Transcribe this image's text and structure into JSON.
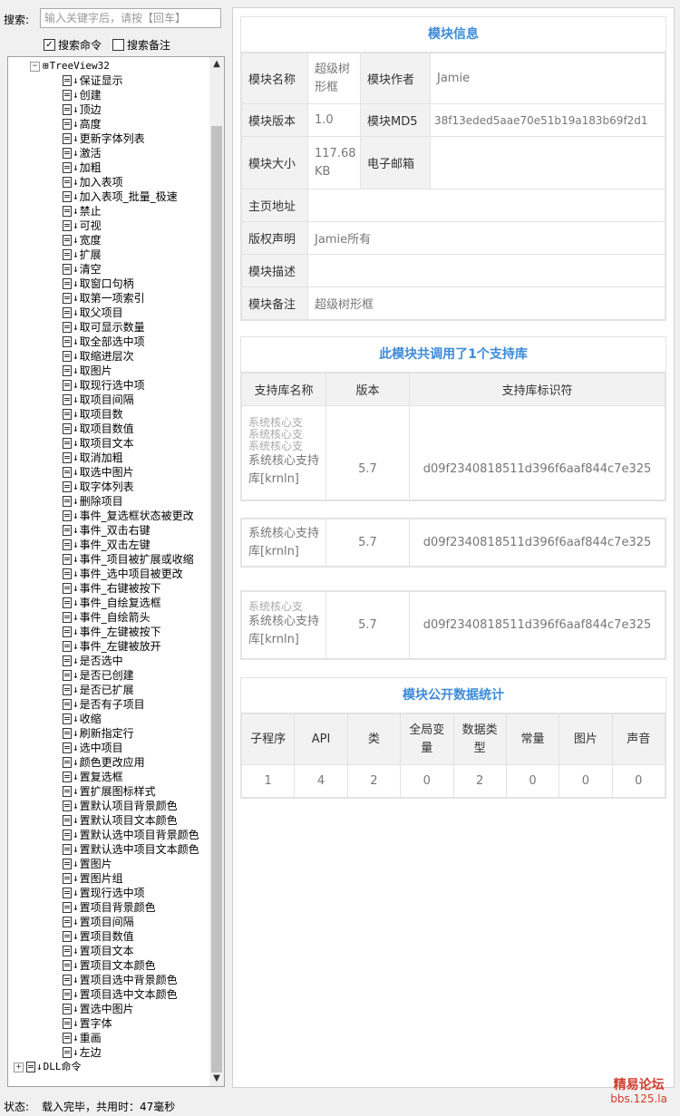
{
  "search": {
    "label": "搜索:",
    "placeholder": "输入关键字后，请按【回车】",
    "cmd_checkbox": "搜索命令",
    "note_checkbox": "搜索备注"
  },
  "tree": {
    "root": "TreeView32",
    "items": [
      "保证显示",
      "创建",
      "顶边",
      "高度",
      "更新字体列表",
      "激活",
      "加粗",
      "加入表项",
      "加入表项_批量_极速",
      "禁止",
      "可视",
      "宽度",
      "扩展",
      "清空",
      "取窗口句柄",
      "取第一项索引",
      "取父项目",
      "取可显示数量",
      "取全部选中项",
      "取缩进层次",
      "取图片",
      "取现行选中项",
      "取项目间隔",
      "取项目数",
      "取项目数值",
      "取项目文本",
      "取消加粗",
      "取选中图片",
      "取字体列表",
      "删除项目",
      "事件_复选框状态被更改",
      "事件_双击右键",
      "事件_双击左键",
      "事件_项目被扩展或收缩",
      "事件_选中项目被更改",
      "事件_右键被按下",
      "事件_自绘复选框",
      "事件_自绘箭头",
      "事件_左键被按下",
      "事件_左键被放开",
      "是否选中",
      "是否已创建",
      "是否已扩展",
      "是否有子项目",
      "收缩",
      "刷新指定行",
      "选中项目",
      "颜色更改应用",
      "置复选框",
      "置扩展图标样式",
      "置默认项目背景颜色",
      "置默认项目文本颜色",
      "置默认选中项目背景颜色",
      "置默认选中项目文本颜色",
      "置图片",
      "置图片组",
      "置现行选中项",
      "置项目背景颜色",
      "置项目间隔",
      "置项目数值",
      "置项目文本",
      "置项目文本颜色",
      "置项目选中背景颜色",
      "置项目选中文本颜色",
      "置选中图片",
      "置字体",
      "重画",
      "左边"
    ],
    "dll_node": "DLL命令"
  },
  "module_info": {
    "title": "模块信息",
    "name_label": "模块名称",
    "name_value": "超级树形框",
    "author_label": "模块作者",
    "author_value": "Jamie",
    "version_label": "模块版本",
    "version_value": "1.0",
    "md5_label": "模块MD5",
    "md5_value": "38f13eded5aae70e51b19a183b69f2d1",
    "size_label": "模块大小",
    "size_value": "117.68 KB",
    "email_label": "电子邮箱",
    "email_value": "",
    "homepage_label": "主页地址",
    "homepage_value": "",
    "copyright_label": "版权声明",
    "copyright_value": "Jamie所有",
    "desc_label": "模块描述",
    "desc_value": "",
    "note_label": "模块备注",
    "note_value": "超级树形框"
  },
  "support_libs": {
    "title": "此模块共调用了1个支持库",
    "headers": [
      "支持库名称",
      "版本",
      "支持库标识符"
    ],
    "ghost_text": "系统核心支",
    "rows": [
      {
        "name": "系统核心支持库[krnln]",
        "version": "5.7",
        "id": "d09f2340818511d396f6aaf844c7e325"
      },
      {
        "name": "系统核心支持库[krnln]",
        "version": "5.7",
        "id": "d09f2340818511d396f6aaf844c7e325"
      },
      {
        "name": "系统核心支持库[krnln]",
        "version": "5.7",
        "id": "d09f2340818511d396f6aaf844c7e325"
      }
    ]
  },
  "stats": {
    "title": "模块公开数据统计",
    "headers": [
      "子程序",
      "API",
      "类",
      "全局变量",
      "数据类型",
      "常量",
      "图片",
      "声音"
    ],
    "values": [
      "1",
      "4",
      "2",
      "0",
      "2",
      "0",
      "0",
      "0"
    ]
  },
  "status": {
    "label": "状态:",
    "text": "载入完毕，共用时：47毫秒"
  },
  "watermark": {
    "line1": "精易论坛",
    "line2": "bbs.125.la"
  },
  "colors": {
    "accent": "#3e8bd8",
    "label_bg": "#f2f2f2",
    "watermark": "#d23b2b"
  }
}
